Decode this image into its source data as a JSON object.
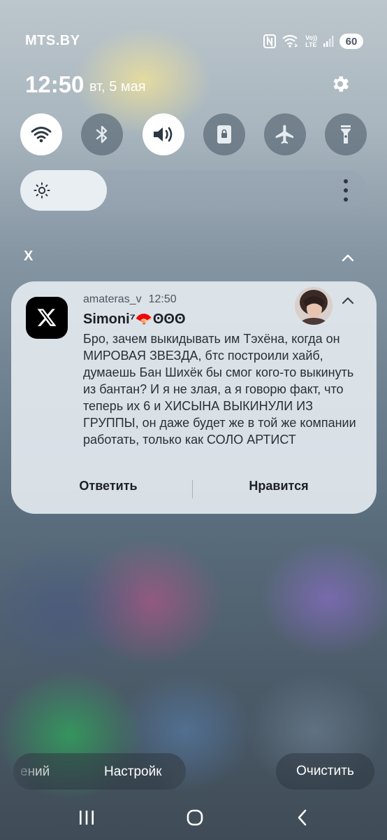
{
  "status_bar": {
    "carrier": "MTS.BY",
    "battery": "60",
    "icons": [
      "nfc-icon",
      "wifi-calling-icon",
      "volte-lte-icon",
      "signal-icon",
      "battery-icon"
    ],
    "volte_label": "Vo))",
    "lte_label": "LTE"
  },
  "header": {
    "time": "12:50",
    "date": "вт, 5 мая",
    "settings_icon": "gear-icon"
  },
  "quick_settings": {
    "toggles": [
      {
        "icon": "wifi-icon",
        "state": "on"
      },
      {
        "icon": "bluetooth-icon",
        "state": "off"
      },
      {
        "icon": "sound-icon",
        "state": "on"
      },
      {
        "icon": "rotation-lock-icon",
        "state": "off"
      },
      {
        "icon": "airplane-icon",
        "state": "off"
      },
      {
        "icon": "flashlight-icon",
        "state": "off"
      }
    ]
  },
  "brightness": {
    "level": 0.25,
    "icon": "sun-icon",
    "more_icon": "more-vertical-icon"
  },
  "notification_group": {
    "app_label": "X",
    "collapse_icon": "chevron-up-icon"
  },
  "notification": {
    "app_icon": "x-logo-icon",
    "account": "amateras_v",
    "time": "12:50",
    "sender": "Simoni⁷🪭ʘʘʘ",
    "body": "Бро, зачем выкидывать им Тэхёна, когда он МИРОВАЯ ЗВЕЗДА, бтс построили хайб, думаешь Бан Шихёк бы смог кого-то выкинуть из бантан? И я не злая, а я говорю факт, что теперь их 6 и ХИСЫНА ВЫКИНУЛИ ИЗ ГРУППЫ, он даже будет же в той же компании работать, только как СОЛО АРТИСТ",
    "actions": {
      "reply": "Ответить",
      "like": "Нравится"
    }
  },
  "bottom_actions": {
    "left_partial": "ений",
    "settings": "Настройк",
    "clear": "Очистить"
  },
  "nav_bar": {
    "recents_icon": "recents-icon",
    "home_icon": "home-icon",
    "back_icon": "back-icon"
  },
  "colors": {
    "card_bg": "#e2e8ee",
    "toggle_on": "#ffffff",
    "toggle_off": "#46556280",
    "app_icon_bg": "#000000"
  }
}
